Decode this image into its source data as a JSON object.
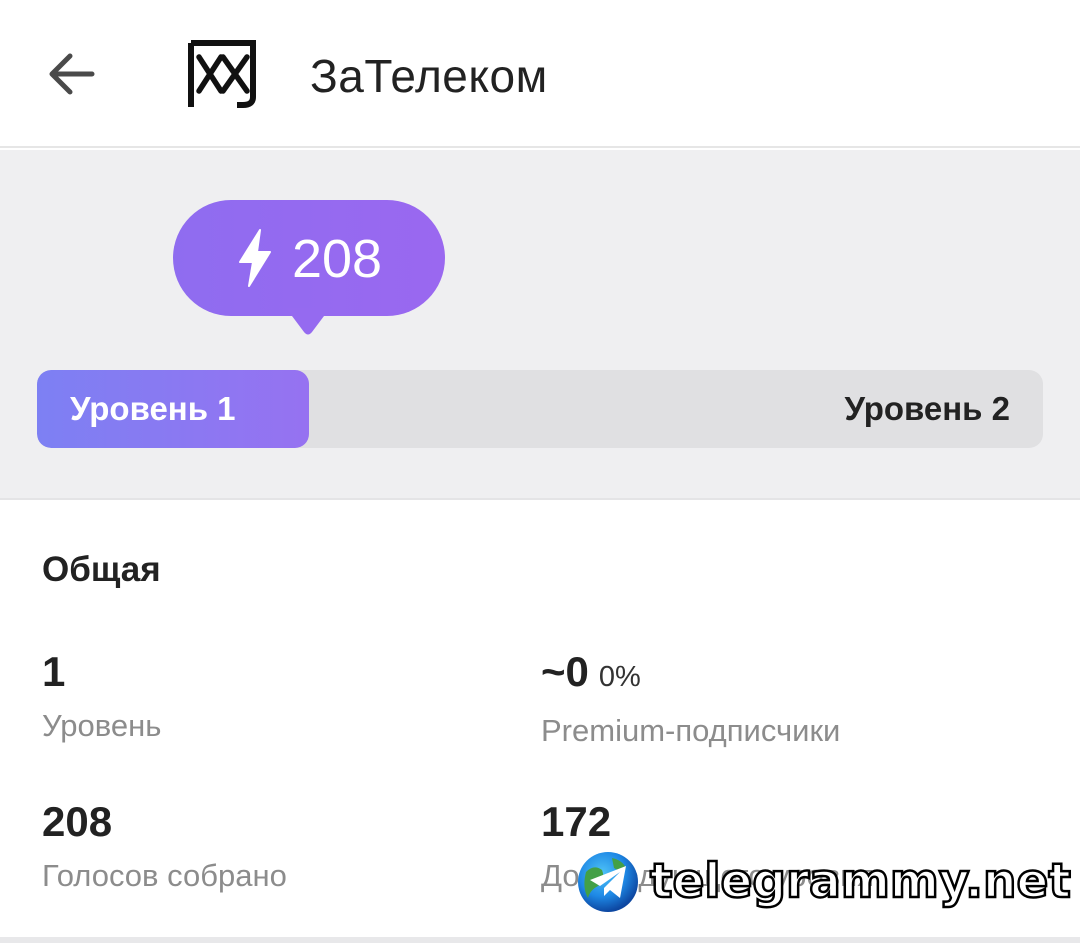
{
  "header": {
    "back_icon": "arrow-left-icon",
    "avatar_icon": "chinese-character-logo",
    "avatar_glyph": "网",
    "title": "ЗаТелеком"
  },
  "boost": {
    "icon": "lightning-icon",
    "count": "208",
    "level_current": "Уровень 1",
    "level_next": "Уровень 2",
    "progress_fraction": 0.27,
    "colors": {
      "accent_start": "#7d80f3",
      "accent_end": "#9672f1",
      "bubble": "#946af0"
    }
  },
  "stats": {
    "title": "Общая",
    "items": [
      {
        "value": "1",
        "label": "Уровень"
      },
      {
        "value": "~0",
        "percent": "0%",
        "label": "Premium-подписчики"
      },
      {
        "value": "208",
        "label": "Голосов собрано"
      },
      {
        "value": "172",
        "label": "До следующего уровня"
      }
    ]
  },
  "watermark": {
    "icon": "telegram-globe-icon",
    "text": "telegrammy.net"
  }
}
